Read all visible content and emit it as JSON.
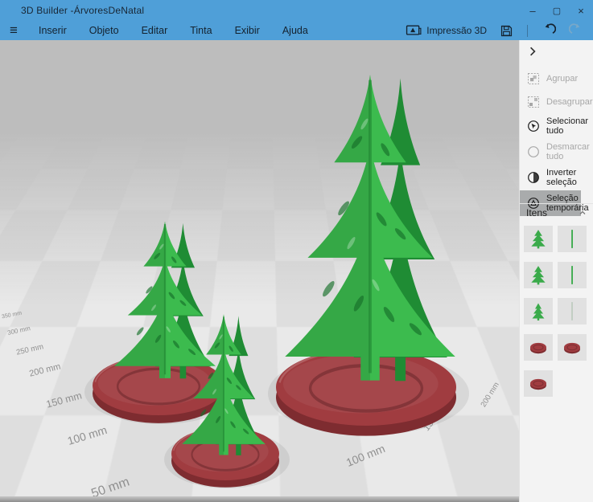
{
  "window": {
    "title": "3D Builder -ÁrvoresDeNatal"
  },
  "icons": {
    "hamburger": "≡",
    "minimize": "–",
    "maximize": "▢",
    "close": "×"
  },
  "menu": {
    "items": [
      "Inserir",
      "Objeto",
      "Editar",
      "Tinta",
      "Exibir",
      "Ajuda"
    ]
  },
  "toolbar": {
    "print_label": "Impressão 3D"
  },
  "sidebar": {
    "tools": [
      {
        "label": "Agrupar",
        "state": "disabled"
      },
      {
        "label": "Desagrupar",
        "state": "disabled"
      },
      {
        "label": "Selecionar tudo",
        "state": "enabled"
      },
      {
        "label": "Desmarcar tudo",
        "state": "disabled"
      },
      {
        "label": "Inverter seleção",
        "state": "enabled"
      },
      {
        "label": "Seleção temporária",
        "state": "selected"
      }
    ],
    "items_header": "Itens",
    "items": [
      {
        "kind": "tree"
      },
      {
        "kind": "trunk-plane"
      },
      {
        "kind": "tree"
      },
      {
        "kind": "trunk-plane"
      },
      {
        "kind": "tree"
      },
      {
        "kind": "trunk-plane-faint"
      },
      {
        "kind": "base-disc"
      },
      {
        "kind": "base-disc"
      },
      {
        "kind": "base-disc"
      }
    ]
  },
  "viewport": {
    "ruler_labels": [
      "350 mm",
      "300 mm",
      "250 mm",
      "200 mm",
      "150 mm",
      "100 mm",
      "50 mm",
      "100 mm",
      "150 mm",
      "200 mm"
    ]
  },
  "colors": {
    "titlebar_blue": "#4f9fd8",
    "tree_green": "#3cbb4e",
    "tree_green_dark": "#1f8c34",
    "base_red": "#a03c40",
    "base_red_dark": "#7e2c30"
  }
}
